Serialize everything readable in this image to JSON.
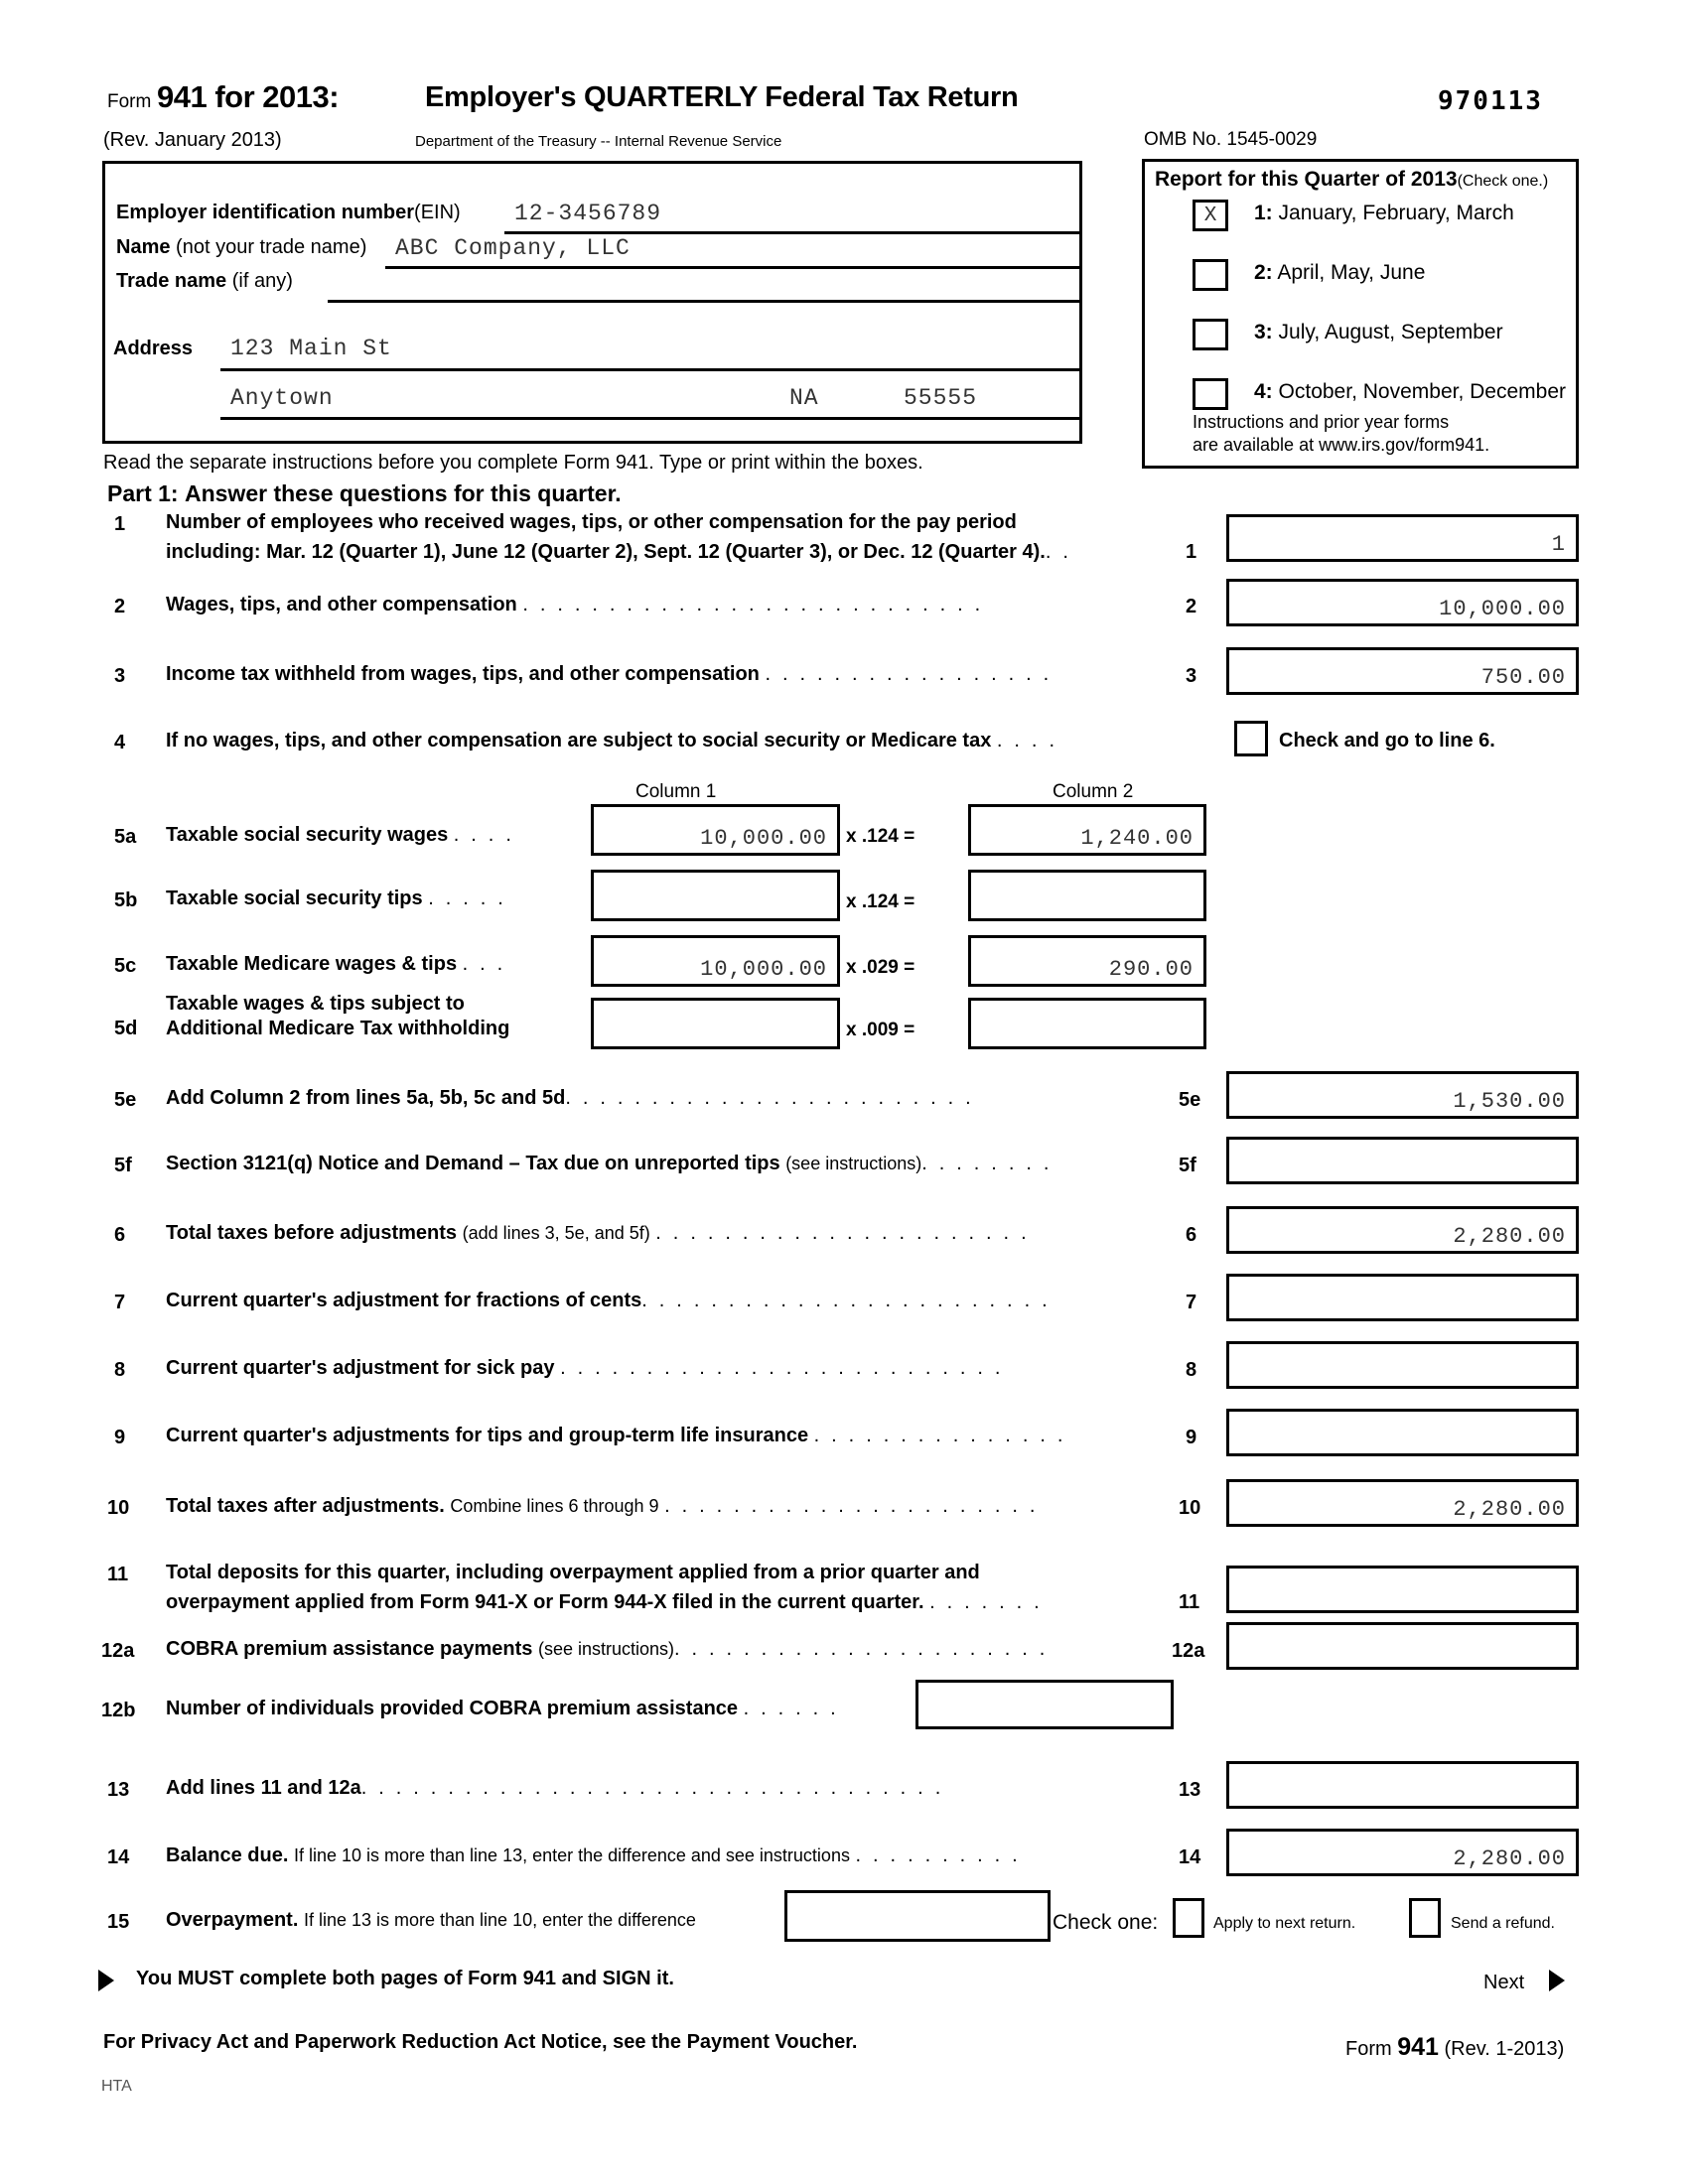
{
  "header": {
    "form_word": "Form",
    "form_number_year": "941 for 2013:",
    "title": "Employer's QUARTERLY Federal Tax Return",
    "revision": "(Rev. January 2013)",
    "department": "Department of the Treasury -- Internal Revenue Service",
    "omb": "OMB No. 1545-0029",
    "barcode": "970113"
  },
  "employer": {
    "ein_label_bold": "Employer identification number",
    "ein_label_light": "(EIN)",
    "ein_value": "12-3456789",
    "name_label_bold": "Name",
    "name_label_light": "(not your trade name)",
    "name_value": "ABC Company, LLC",
    "trade_label_bold": "Trade name",
    "trade_label_light": "(if any)",
    "trade_value": "",
    "address_label": "Address",
    "address_value": "123 Main St",
    "city_value": "Anytown",
    "state_value": "NA",
    "zip_value": "55555"
  },
  "quarter": {
    "heading_bold": "Report for this Quarter of 2013",
    "heading_light": "(Check one.)",
    "options": [
      {
        "num": "1:",
        "label": "January, February, March",
        "checked": "X"
      },
      {
        "num": "2:",
        "label": "April, May, June",
        "checked": ""
      },
      {
        "num": "3:",
        "label": "July, August, September",
        "checked": ""
      },
      {
        "num": "4:",
        "label": "October, November, December",
        "checked": ""
      }
    ],
    "footnote_line1": "Instructions and prior year forms",
    "footnote_line2": "are available at www.irs.gov/form941."
  },
  "instructions": "Read the separate instructions before you complete Form 941. Type or print within the boxes.",
  "part1": {
    "heading_bold": "Part 1:",
    "heading_light": "Answer these questions for this quarter.",
    "columns": {
      "col1": "Column 1",
      "col2": "Column 2"
    },
    "line1": {
      "no": "1",
      "text_a": "Number of employees who received wages, tips, or other compensation for the pay period",
      "text_b": "including: Mar. 12 (Quarter 1), June 12 (Quarter 2), Sept. 12 (Quarter 3), or Dec. 12 (Quarter 4).",
      "dots": ". .",
      "ref": "1",
      "value": "1"
    },
    "line2": {
      "no": "2",
      "text": "Wages, tips, and other compensation",
      "dots": ". . . . . . . . . . . . . . . . . . . . . . . . . . .",
      "ref": "2",
      "value": "10,000.00"
    },
    "line3": {
      "no": "3",
      "text": "Income tax withheld from wages, tips, and other compensation",
      "dots": ". . . . . . . . . . . . . . . . .",
      "ref": "3",
      "value": "750.00"
    },
    "line4": {
      "no": "4",
      "text": "If no wages, tips, and other compensation are subject to social security or Medicare tax",
      "dots": ". . . .",
      "checkbox_label": "Check and go to line 6.",
      "checked": ""
    },
    "line5a": {
      "no": "5a",
      "text": "Taxable social security wages",
      "dots": ". . . .",
      "col1": "10,000.00",
      "rate": "x  .124  =",
      "col2": "1,240.00"
    },
    "line5b": {
      "no": "5b",
      "text": "Taxable social security tips",
      "dots": ". . . . .",
      "col1": "",
      "rate": "x  .124  =",
      "col2": ""
    },
    "line5c": {
      "no": "5c",
      "text": "Taxable Medicare wages & tips",
      "dots": ". . .",
      "col1": "10,000.00",
      "rate": "x  .029  =",
      "col2": "290.00"
    },
    "line5d": {
      "no": "5d",
      "text_a": "Taxable wages & tips subject to",
      "text_b": "Additional Medicare Tax withholding",
      "col1": "",
      "rate": "x  .009  =",
      "col2": ""
    },
    "line5e": {
      "no": "5e",
      "text": "Add Column 2 from lines 5a, 5b, 5c and 5d",
      "dots": ". . . . . . . . . . . . . . . . . . . . . . . .",
      "ref": "5e",
      "value": "1,530.00"
    },
    "line5f": {
      "no": "5f",
      "text": "Section 3121(q) Notice and Demand – Tax due on unreported tips",
      "sub": "(see instructions)",
      "dots": ". . . . . . . .",
      "ref": "5f",
      "value": ""
    },
    "line6": {
      "no": "6",
      "text": "Total taxes before adjustments",
      "sub": "(add lines 3, 5e, and 5f)",
      "dots": ". . . . . . . . . . . . . . . . . . . . . .",
      "ref": "6",
      "value": "2,280.00"
    },
    "line7": {
      "no": "7",
      "text": "Current quarter's adjustment for fractions of cents",
      "dots": ". . . . . . . . . . . . . . . . . . . . . . . .",
      "ref": "7",
      "value": ""
    },
    "line8": {
      "no": "8",
      "text": "Current quarter's adjustment for sick pay",
      "dots": ". . . . . . . . . . . . . . . . . . . . . . . . . .",
      "ref": "8",
      "value": ""
    },
    "line9": {
      "no": "9",
      "text": "Current quarter's adjustments for tips and group-term life insurance",
      "dots": ". . . . . . . . . . . . . . .",
      "ref": "9",
      "value": ""
    },
    "line10": {
      "no": "10",
      "text": "Total taxes after adjustments.",
      "sub": "Combine lines 6 through 9",
      "dots": ". . . . . . . . . . . . . . . . . . . . . .",
      "ref": "10",
      "value": "2,280.00"
    },
    "line11": {
      "no": "11",
      "text_a": "Total deposits for this quarter, including overpayment applied from a prior quarter and",
      "text_b": "overpayment applied from Form 941-X or Form 944-X filed in the current quarter.",
      "dots": ". . . . . . .",
      "ref": "11",
      "value": ""
    },
    "line12a": {
      "no": "12a",
      "text": "COBRA premium assistance payments",
      "sub": "(see instructions)",
      "dots": ". . . . . . . . . . . . . . . . . . . . . .",
      "ref": "12a",
      "value": ""
    },
    "line12b": {
      "no": "12b",
      "text": "Number of individuals provided COBRA premium assistance",
      "dots": ". . . . . .",
      "value": ""
    },
    "line13": {
      "no": "13",
      "text": "Add lines 11 and 12a",
      "dots": ". . . . . . . . . . . . . . . . . . . . . . . . . . . . . . . . . .",
      "ref": "13",
      "value": ""
    },
    "line14": {
      "no": "14",
      "text": "Balance due.",
      "sub": "If line 10 is more than line 13, enter the difference and see instructions",
      "dots": ". . . . . . . . . .",
      "ref": "14",
      "value": "2,280.00"
    },
    "line15": {
      "no": "15",
      "text": "Overpayment.",
      "sub": "If line 13 is more than line 10, enter the difference",
      "value": "",
      "check_one": "Check one:",
      "option1": "Apply to next return.",
      "option2": "Send a refund.",
      "checked1": "",
      "checked2": ""
    }
  },
  "footer": {
    "must_complete": "You MUST complete both pages of Form 941 and SIGN it.",
    "next": "Next",
    "privacy": "For Privacy Act and Paperwork Reduction Act Notice, see the Payment Voucher.",
    "form_word": "Form",
    "form_num": "941",
    "form_rev": "(Rev. 1-2013)",
    "hta": "HTA"
  }
}
